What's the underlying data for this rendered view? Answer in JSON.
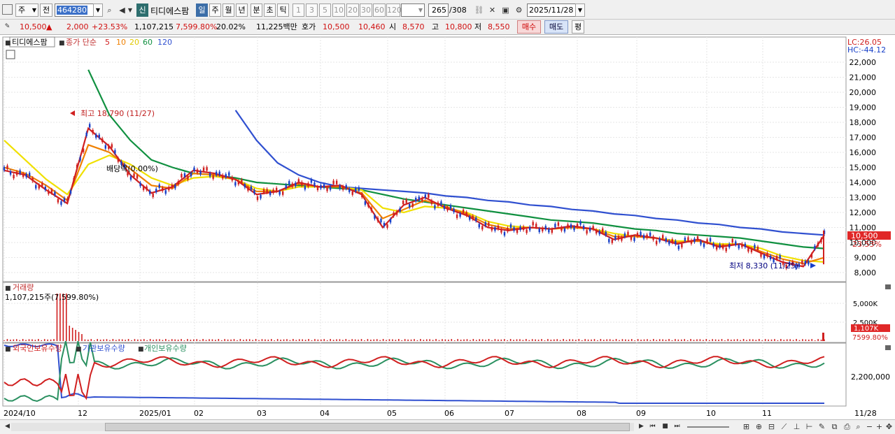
{
  "toolbar": {
    "market_label": "주",
    "prev_label": "전",
    "code_value": "464280",
    "sin_label": "신",
    "stock_name": "티디에스팜",
    "periods": [
      "일",
      "주",
      "월",
      "년",
      "분",
      "초",
      "틱"
    ],
    "active_period": "일",
    "intervals": [
      "1",
      "3",
      "5",
      "10",
      "20",
      "30",
      "60",
      "120"
    ],
    "count_value": "265",
    "count_total": "/308",
    "date_value": "2025/11/28"
  },
  "quote": {
    "price": "10,500",
    "change_arrow": "▲",
    "change": "2,000",
    "change_pct": "+23.53%",
    "volume": "1,107,215",
    "volume_pct": "7,599.80%",
    "turnover_pct": "20.02%",
    "amount": "11,225백만",
    "hoga_label": "호가",
    "ask": "10,500",
    "bid": "10,460",
    "open_label": "시",
    "open": "8,570",
    "high_label": "고",
    "high": "10,800",
    "low_label": "저",
    "low": "8,550",
    "buy_label": "매수",
    "sell_label": "매도",
    "flat_label": "평"
  },
  "price_panel": {
    "stock_tag": "티디에스팜",
    "ma_label": "종가 단순",
    "ma_periods": [
      "5",
      "10",
      "20",
      "60",
      "120"
    ],
    "ma_colors": [
      "#d02020",
      "#f08000",
      "#f0e000",
      "#109040",
      "#3050d0"
    ],
    "lc_label": "LC:26.05",
    "hc_label": "HC:-44.12",
    "y_ticks": [
      "22,000",
      "21,000",
      "20,000",
      "19,000",
      "18,000",
      "17,000",
      "16,000",
      "15,000",
      "14,000",
      "13,000",
      "12,000",
      "11,000",
      "10,000",
      "9,000",
      "8,000"
    ],
    "current_price_tag": "10,500",
    "current_pct_tag": "23.53%",
    "high_annotation": "최고 18,790 (11/27)",
    "low_annotation": "최저 8,330 (11/25)",
    "dividend_annotation": "배당락(0.00%)"
  },
  "volume_panel": {
    "title": "거래량",
    "value_label": "1,107,215주(7,599.80%)",
    "y_ticks": [
      "5,000K",
      "2,500K"
    ],
    "current_tag": "1,107K",
    "current_pct_tag": "7599.80%"
  },
  "holding_panel": {
    "labels": [
      "외국인보유수량",
      "기관보유수량",
      "개인보유수량"
    ],
    "colors": [
      "#d02020",
      "#3050d0",
      "#2a9060"
    ],
    "y_tick": "2,200,000"
  },
  "x_axis": {
    "labels": [
      "2024/10",
      "12",
      "2025/01",
      "02",
      "03",
      "04",
      "05",
      "06",
      "07",
      "08",
      "09",
      "10",
      "11"
    ],
    "current_date": "11/28"
  },
  "chart_data": {
    "type": "line",
    "title": "",
    "period": "daily",
    "x_range": [
      "2024/10",
      "2025/11/28"
    ],
    "ylim": [
      8000,
      22000
    ],
    "series": [
      {
        "name": "5",
        "color": "#d02020",
        "values": [
          14800,
          14500,
          13500,
          12600,
          17600,
          16400,
          14500,
          13300,
          13700,
          14800,
          14600,
          14200,
          13200,
          13400,
          14000,
          13700,
          13800,
          13200,
          11000,
          12500,
          13000,
          12300,
          11800,
          11000,
          10800,
          11000,
          10900,
          11100,
          10900,
          10200,
          10500,
          10300,
          9900,
          10200,
          9700,
          9900,
          9300,
          8700,
          8400,
          10500
        ]
      },
      {
        "name": "10",
        "color": "#f08000",
        "values": [
          15000,
          14600,
          13800,
          12800,
          16500,
          16000,
          14900,
          13800,
          13600,
          14600,
          14500,
          14200,
          13400,
          13400,
          13900,
          13700,
          13700,
          13300,
          11600,
          12200,
          12800,
          12400,
          11900,
          11200,
          10900,
          11000,
          10900,
          11000,
          10900,
          10400,
          10400,
          10300,
          10000,
          10100,
          9800,
          9900,
          9400,
          8900,
          8600,
          9000
        ]
      },
      {
        "name": "20",
        "color": "#f0e000",
        "values": [
          16800,
          15500,
          14200,
          13200,
          15200,
          15800,
          15200,
          14300,
          13800,
          14300,
          14400,
          14200,
          13600,
          13400,
          13700,
          13700,
          13700,
          13500,
          12300,
          12000,
          12400,
          12300,
          12000,
          11400,
          11100,
          11000,
          10900,
          11000,
          10900,
          10600,
          10400,
          10300,
          10100,
          10100,
          9900,
          9900,
          9600,
          9100,
          8800,
          8700
        ]
      },
      {
        "name": "60",
        "color": "#109040",
        "values": [
          null,
          null,
          null,
          null,
          21500,
          18500,
          16800,
          15500,
          15000,
          14600,
          14500,
          14300,
          14000,
          13900,
          13800,
          13700,
          13600,
          13500,
          13200,
          12900,
          12700,
          12500,
          12300,
          12100,
          11900,
          11700,
          11500,
          11400,
          11300,
          11100,
          10900,
          10800,
          10600,
          10500,
          10400,
          10300,
          10100,
          9900,
          9700,
          9600
        ]
      },
      {
        "name": "120",
        "color": "#3050d0",
        "values": [
          null,
          null,
          null,
          null,
          null,
          null,
          null,
          null,
          null,
          null,
          null,
          18800,
          16800,
          15300,
          14500,
          14000,
          13700,
          13600,
          13500,
          13400,
          13300,
          13100,
          13000,
          12800,
          12700,
          12500,
          12400,
          12200,
          12100,
          11900,
          11800,
          11600,
          11500,
          11300,
          11200,
          11000,
          10900,
          10700,
          10600,
          10500
        ]
      }
    ]
  }
}
